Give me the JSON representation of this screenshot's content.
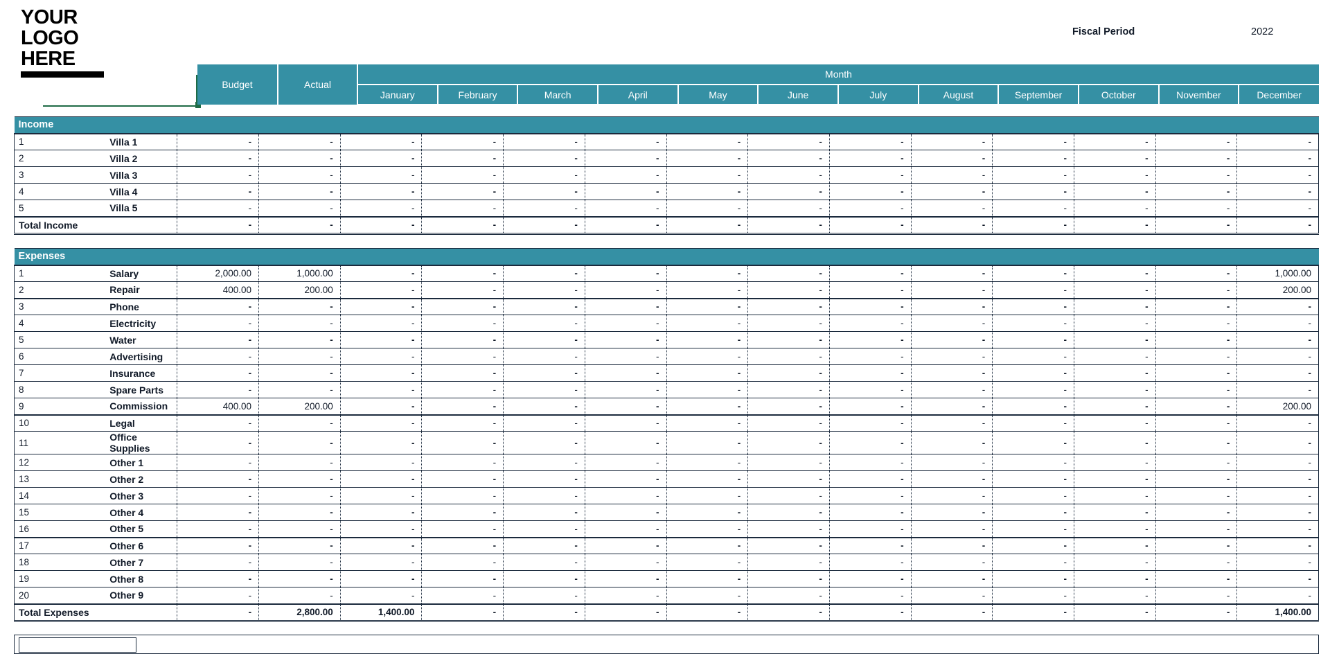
{
  "logo": {
    "line1": "YOUR",
    "line2": "LOGO",
    "line3": "HERE"
  },
  "fiscal": {
    "label": "Fiscal Period",
    "value": "2022"
  },
  "colors": {
    "header_teal": "#3590a4",
    "grid_dark": "#1b2a3d",
    "accent_green": "#1f6b45",
    "text": "#111a28",
    "header_text": "#ffffff"
  },
  "header": {
    "budget": "Budget",
    "actual": "Actual",
    "month_group": "Month",
    "months": [
      "January",
      "February",
      "March",
      "April",
      "May",
      "June",
      "July",
      "August",
      "September",
      "October",
      "November",
      "December"
    ]
  },
  "income": {
    "banner": "Income",
    "total_label": "Total Income",
    "rows": [
      {
        "no": "1",
        "name": "Villa 1",
        "budget": "-",
        "actual": "-",
        "months": [
          "-",
          "-",
          "-",
          "-",
          "-",
          "-",
          "-",
          "-",
          "-",
          "-",
          "-",
          "-"
        ]
      },
      {
        "no": "2",
        "name": "Villa 2",
        "budget": "-",
        "actual": "-",
        "months": [
          "-",
          "-",
          "-",
          "-",
          "-",
          "-",
          "-",
          "-",
          "-",
          "-",
          "-",
          "-"
        ]
      },
      {
        "no": "3",
        "name": "Villa 3",
        "budget": "-",
        "actual": "-",
        "months": [
          "-",
          "-",
          "-",
          "-",
          "-",
          "-",
          "-",
          "-",
          "-",
          "-",
          "-",
          "-"
        ]
      },
      {
        "no": "4",
        "name": "Villa 4",
        "budget": "-",
        "actual": "-",
        "months": [
          "-",
          "-",
          "-",
          "-",
          "-",
          "-",
          "-",
          "-",
          "-",
          "-",
          "-",
          "-"
        ]
      },
      {
        "no": "5",
        "name": "Villa 5",
        "budget": "-",
        "actual": "-",
        "months": [
          "-",
          "-",
          "-",
          "-",
          "-",
          "-",
          "-",
          "-",
          "-",
          "-",
          "-",
          "-"
        ]
      }
    ],
    "total": {
      "pre": "-",
      "budget": "-",
      "actual": "-",
      "months": [
        "-",
        "-",
        "-",
        "-",
        "-",
        "-",
        "-",
        "-",
        "-",
        "-",
        "-",
        "-"
      ]
    }
  },
  "expenses": {
    "banner": "Expenses",
    "total_label": "Total Expenses",
    "rows": [
      {
        "no": "1",
        "name": "Salary",
        "budget": "2,000.00",
        "actual": "1,000.00",
        "months": [
          "-",
          "-",
          "-",
          "-",
          "-",
          "-",
          "-",
          "-",
          "-",
          "-",
          "-",
          "1,000.00"
        ]
      },
      {
        "no": "2",
        "name": "Repair",
        "budget": "400.00",
        "actual": "200.00",
        "months": [
          "-",
          "-",
          "-",
          "-",
          "-",
          "-",
          "-",
          "-",
          "-",
          "-",
          "-",
          "200.00"
        ]
      },
      {
        "no": "3",
        "name": "Phone",
        "budget": "-",
        "actual": "-",
        "months": [
          "-",
          "-",
          "-",
          "-",
          "-",
          "-",
          "-",
          "-",
          "-",
          "-",
          "-",
          "-"
        ]
      },
      {
        "no": "4",
        "name": "Electricity",
        "budget": "-",
        "actual": "-",
        "months": [
          "-",
          "-",
          "-",
          "-",
          "-",
          "-",
          "-",
          "-",
          "-",
          "-",
          "-",
          "-"
        ]
      },
      {
        "no": "5",
        "name": "Water",
        "budget": "-",
        "actual": "-",
        "months": [
          "-",
          "-",
          "-",
          "-",
          "-",
          "-",
          "-",
          "-",
          "-",
          "-",
          "-",
          "-"
        ]
      },
      {
        "no": "6",
        "name": "Advertising",
        "budget": "-",
        "actual": "-",
        "months": [
          "-",
          "-",
          "-",
          "-",
          "-",
          "-",
          "-",
          "-",
          "-",
          "-",
          "-",
          "-"
        ]
      },
      {
        "no": "7",
        "name": "Insurance",
        "budget": "-",
        "actual": "-",
        "months": [
          "-",
          "-",
          "-",
          "-",
          "-",
          "-",
          "-",
          "-",
          "-",
          "-",
          "-",
          "-"
        ]
      },
      {
        "no": "8",
        "name": "Spare Parts",
        "budget": "-",
        "actual": "-",
        "months": [
          "-",
          "-",
          "-",
          "-",
          "-",
          "-",
          "-",
          "-",
          "-",
          "-",
          "-",
          "-"
        ]
      },
      {
        "no": "9",
        "name": "Commission",
        "budget": "400.00",
        "actual": "200.00",
        "months": [
          "-",
          "-",
          "-",
          "-",
          "-",
          "-",
          "-",
          "-",
          "-",
          "-",
          "-",
          "200.00"
        ]
      },
      {
        "no": "10",
        "name": "Legal",
        "budget": "-",
        "actual": "-",
        "months": [
          "-",
          "-",
          "-",
          "-",
          "-",
          "-",
          "-",
          "-",
          "-",
          "-",
          "-",
          "-"
        ]
      },
      {
        "no": "11",
        "name": "Office Supplies",
        "budget": "-",
        "actual": "-",
        "months": [
          "-",
          "-",
          "-",
          "-",
          "-",
          "-",
          "-",
          "-",
          "-",
          "-",
          "-",
          "-"
        ]
      },
      {
        "no": "12",
        "name": "Other 1",
        "budget": "-",
        "actual": "-",
        "months": [
          "-",
          "-",
          "-",
          "-",
          "-",
          "-",
          "-",
          "-",
          "-",
          "-",
          "-",
          "-"
        ]
      },
      {
        "no": "13",
        "name": "Other 2",
        "budget": "-",
        "actual": "-",
        "months": [
          "-",
          "-",
          "-",
          "-",
          "-",
          "-",
          "-",
          "-",
          "-",
          "-",
          "-",
          "-"
        ]
      },
      {
        "no": "14",
        "name": "Other 3",
        "budget": "-",
        "actual": "-",
        "months": [
          "-",
          "-",
          "-",
          "-",
          "-",
          "-",
          "-",
          "-",
          "-",
          "-",
          "-",
          "-"
        ]
      },
      {
        "no": "15",
        "name": "Other 4",
        "budget": "-",
        "actual": "-",
        "months": [
          "-",
          "-",
          "-",
          "-",
          "-",
          "-",
          "-",
          "-",
          "-",
          "-",
          "-",
          "-"
        ]
      },
      {
        "no": "16",
        "name": "Other 5",
        "budget": "-",
        "actual": "-",
        "months": [
          "-",
          "-",
          "-",
          "-",
          "-",
          "-",
          "-",
          "-",
          "-",
          "-",
          "-",
          "-"
        ]
      },
      {
        "no": "17",
        "name": "Other 6",
        "budget": "-",
        "actual": "-",
        "months": [
          "-",
          "-",
          "-",
          "-",
          "-",
          "-",
          "-",
          "-",
          "-",
          "-",
          "-",
          "-"
        ]
      },
      {
        "no": "18",
        "name": "Other 7",
        "budget": "-",
        "actual": "-",
        "months": [
          "-",
          "-",
          "-",
          "-",
          "-",
          "-",
          "-",
          "-",
          "-",
          "-",
          "-",
          "-"
        ]
      },
      {
        "no": "19",
        "name": "Other 8",
        "budget": "-",
        "actual": "-",
        "months": [
          "-",
          "-",
          "-",
          "-",
          "-",
          "-",
          "-",
          "-",
          "-",
          "-",
          "-",
          "-"
        ]
      },
      {
        "no": "20",
        "name": "Other 9",
        "budget": "-",
        "actual": "-",
        "months": [
          "-",
          "-",
          "-",
          "-",
          "-",
          "-",
          "-",
          "-",
          "-",
          "-",
          "-",
          "-"
        ]
      }
    ],
    "total": {
      "pre": "-",
      "budget": "2,800.00",
      "actual": "1,400.00",
      "months": [
        "-",
        "-",
        "-",
        "-",
        "-",
        "-",
        "-",
        "-",
        "-",
        "-",
        "-",
        "1,400.00"
      ]
    }
  }
}
